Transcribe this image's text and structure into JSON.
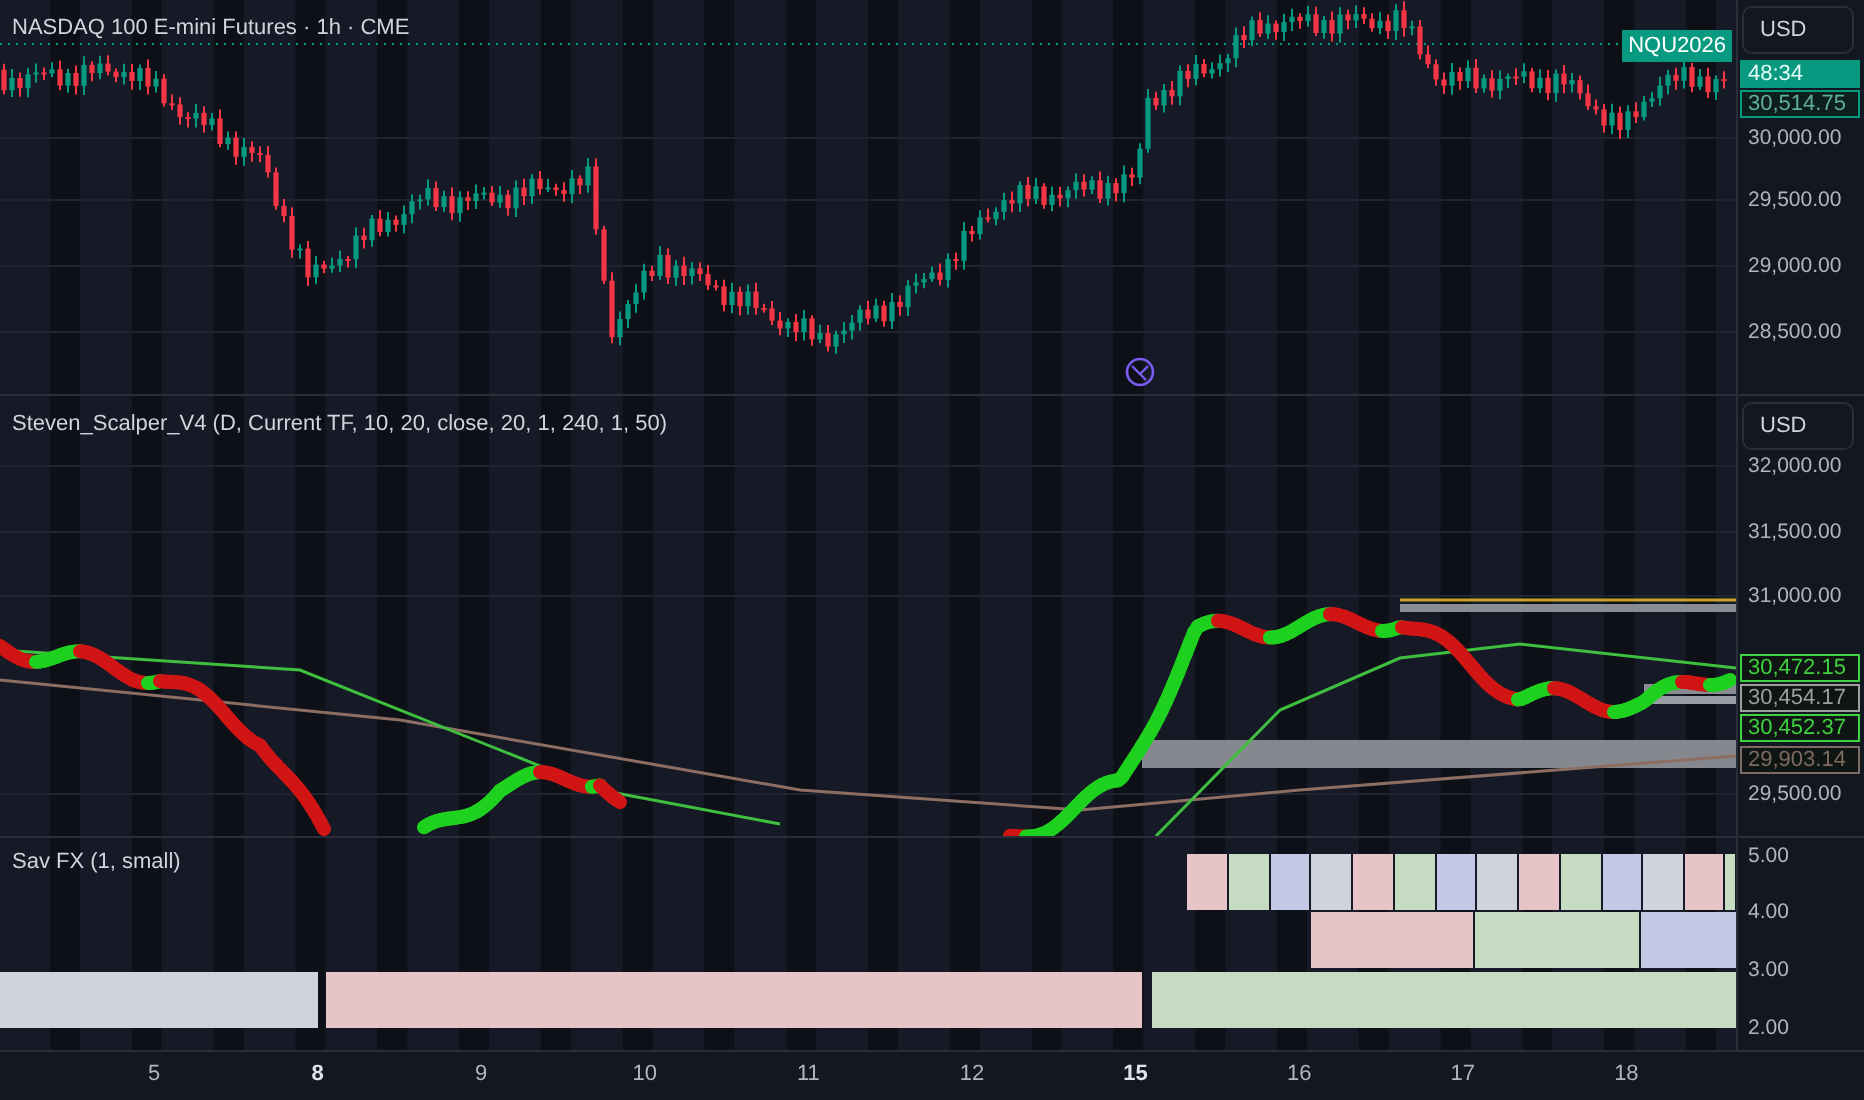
{
  "main_pane": {
    "title": "NASDAQ 100 E-mini Futures · 1h · CME",
    "currency": "USD",
    "symbol_badge": "NQU2026",
    "countdown": "48:34",
    "last_price": "30,514.75",
    "price_ticks": [
      "30,000.00",
      "29,500.00",
      "29,000.00",
      "28,500.00"
    ]
  },
  "indicator_pane": {
    "title": "Steven_Scalper_V4 (D, Current TF, 10, 20, close, 20, 1, 240, 1, 50)",
    "currency": "USD",
    "price_ticks": [
      "32,000.00",
      "31,500.00",
      "31,000.00",
      "29,500.00"
    ],
    "price_labels": [
      {
        "text": "30,472.15",
        "color": "#3fd13f"
      },
      {
        "text": "30,454.17",
        "color": "#9e9e9e"
      },
      {
        "text": "30,452.37",
        "color": "#3fd13f"
      },
      {
        "text": "29,903.14",
        "color": "#7d6a60"
      }
    ]
  },
  "sav_pane": {
    "title": "Sav FX  (1, small)",
    "ticks": [
      "5.00",
      "4.00",
      "3.00",
      "2.00"
    ]
  },
  "time_axis": [
    {
      "label": "5",
      "emphasized": false
    },
    {
      "label": "8",
      "emphasized": true
    },
    {
      "label": "9",
      "emphasized": false
    },
    {
      "label": "10",
      "emphasized": false
    },
    {
      "label": "11",
      "emphasized": false
    },
    {
      "label": "12",
      "emphasized": false
    },
    {
      "label": "15",
      "emphasized": true
    },
    {
      "label": "16",
      "emphasized": false
    },
    {
      "label": "17",
      "emphasized": false
    },
    {
      "label": "18",
      "emphasized": false
    }
  ]
}
